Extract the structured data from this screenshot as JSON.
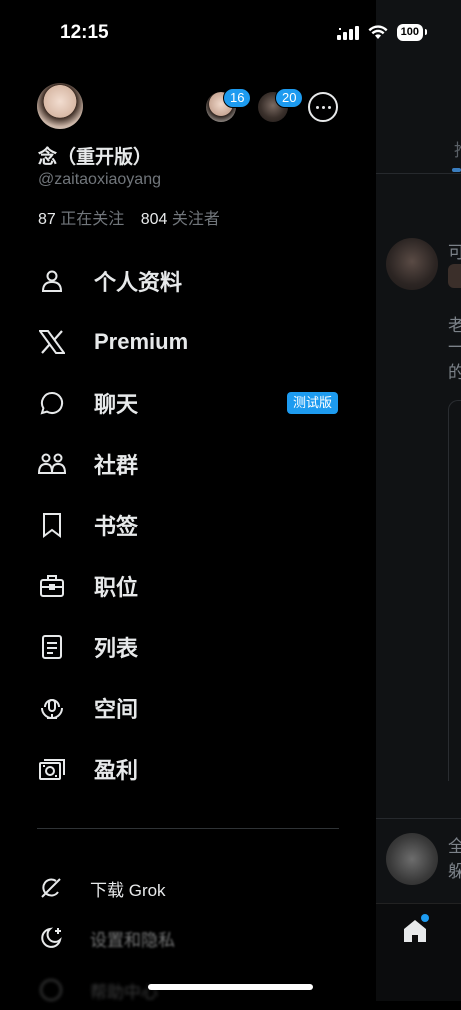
{
  "status": {
    "time": "12:15",
    "battery": "100"
  },
  "profile": {
    "display_name": "念（重开版）",
    "handle": "@zaitaoxiaoyang",
    "following_count": "87",
    "following_label": "正在关注",
    "followers_count": "804",
    "followers_label": "关注者"
  },
  "accounts": [
    {
      "badge": "16"
    },
    {
      "badge": "20"
    }
  ],
  "menu": [
    {
      "label": "个人资料",
      "icon": "person-icon"
    },
    {
      "label": "Premium",
      "icon": "x-logo-icon"
    },
    {
      "label": "聊天",
      "icon": "chat-bubble-icon",
      "badge": "测试版"
    },
    {
      "label": "社群",
      "icon": "communities-icon"
    },
    {
      "label": "书签",
      "icon": "bookmark-icon"
    },
    {
      "label": "职位",
      "icon": "briefcase-icon"
    },
    {
      "label": "列表",
      "icon": "list-icon"
    },
    {
      "label": "空间",
      "icon": "spaces-icon"
    },
    {
      "label": "盈利",
      "icon": "monetization-icon"
    }
  ],
  "secondary": [
    {
      "label": "下载 Grok",
      "icon": "grok-icon"
    },
    {
      "label": "设置和隐私",
      "icon": "moon-icon"
    },
    {
      "label": "帮助中心",
      "icon": "help-icon"
    }
  ],
  "timeline": {
    "tab_char": "推",
    "post1_line1": "可",
    "post1_line2": "老",
    "post1_line3": "一",
    "post1_line4": "的",
    "post2_line1": "全",
    "post2_line2": "躲"
  },
  "colors": {
    "accent": "#1d9bf0",
    "background": "#000000",
    "text": "#e7e9ea",
    "muted": "#71767b"
  }
}
